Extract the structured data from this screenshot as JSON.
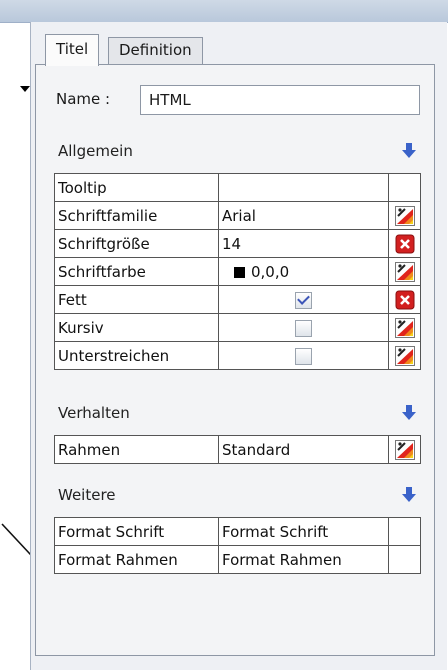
{
  "tabs": {
    "titel": "Titel",
    "definition": "Definition"
  },
  "name": {
    "label": "Name :",
    "value": "HTML"
  },
  "sections": {
    "allgemein": "Allgemein",
    "verhalten": "Verhalten",
    "weitere": "Weitere"
  },
  "allgemein_rows": [
    {
      "property": "Tooltip",
      "value": "",
      "action": "none"
    },
    {
      "property": "Schriftfamilie",
      "value": "Arial",
      "action": "edit-icon"
    },
    {
      "property": "Schriftgröße",
      "value": "14",
      "action": "reset-icon"
    },
    {
      "property": "Schriftfarbe",
      "value": "0,0,0",
      "swatch_color": "#000000",
      "action": "edit-icon"
    },
    {
      "property": "Fett",
      "value": true,
      "action": "reset-icon"
    },
    {
      "property": "Kursiv",
      "value": false,
      "action": "edit-icon"
    },
    {
      "property": "Unterstreichen",
      "value": false,
      "action": "edit-icon"
    }
  ],
  "verhalten_rows": [
    {
      "property": "Rahmen",
      "value": "Standard",
      "action": "edit-icon"
    }
  ],
  "weitere_rows": [
    {
      "property": "Format Schrift",
      "value": "Format Schrift"
    },
    {
      "property": "Format Rahmen",
      "value": "Format Rahmen"
    }
  ],
  "colors": {
    "section_arrow": "#3a62c9",
    "reset_red": "#d22020",
    "checkbox_check": "#3d55b8"
  }
}
